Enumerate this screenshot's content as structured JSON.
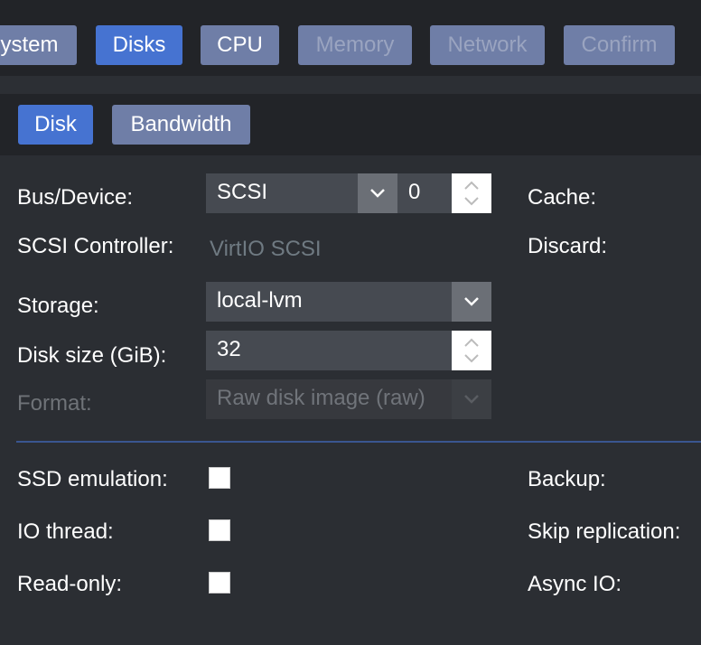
{
  "wizard_tabs": [
    {
      "label": "ystem",
      "state": "normal"
    },
    {
      "label": "Disks",
      "state": "active"
    },
    {
      "label": "CPU",
      "state": "normal"
    },
    {
      "label": "Memory",
      "state": "disabled"
    },
    {
      "label": "Network",
      "state": "disabled"
    },
    {
      "label": "Confirm",
      "state": "disabled"
    }
  ],
  "sub_tabs": [
    {
      "label": "Disk",
      "state": "active"
    },
    {
      "label": "Bandwidth",
      "state": "normal"
    }
  ],
  "form": {
    "bus_device": {
      "label": "Bus/Device:",
      "bus": "SCSI",
      "device": "0"
    },
    "scsi_controller": {
      "label": "SCSI Controller:",
      "value": "VirtIO SCSI"
    },
    "storage": {
      "label": "Storage:",
      "value": "local-lvm"
    },
    "disk_size": {
      "label": "Disk size (GiB):",
      "value": "32"
    },
    "format": {
      "label": "Format:",
      "value": "Raw disk image (raw)"
    },
    "cache": {
      "label": "Cache:"
    },
    "discard": {
      "label": "Discard:"
    },
    "ssd": {
      "label": "SSD emulation:"
    },
    "io_thread": {
      "label": "IO thread:"
    },
    "read_only": {
      "label": "Read-only:"
    },
    "backup": {
      "label": "Backup:"
    },
    "skip_replication": {
      "label": "Skip replication:"
    },
    "async_io": {
      "label": "Async IO:"
    }
  }
}
